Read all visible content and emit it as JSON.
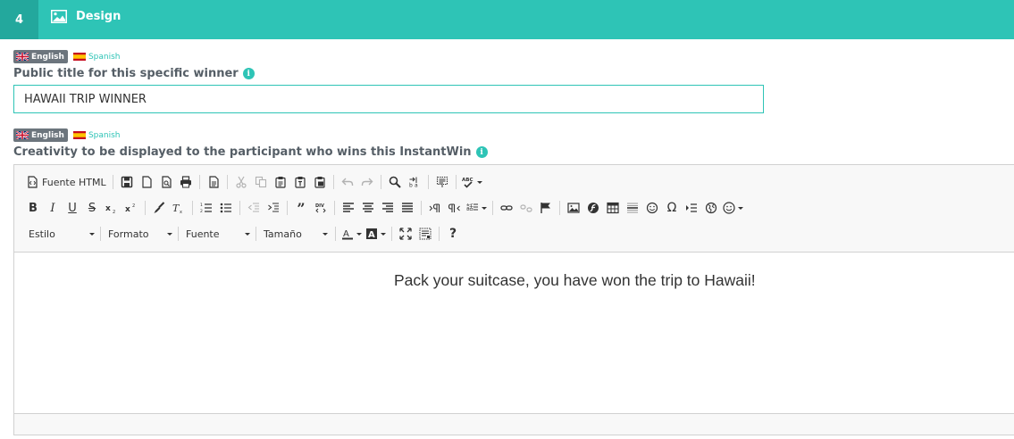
{
  "step": {
    "number": "4",
    "icon": "image-icon",
    "label": "Design"
  },
  "languages": [
    {
      "code": "en",
      "label": "English",
      "flag": "uk-flag-icon",
      "active": true
    },
    {
      "code": "es",
      "label": "Spanish",
      "flag": "spain-flag-icon",
      "active": false
    }
  ],
  "title_field": {
    "label": "Public title for this specific winner",
    "value": "HAWAII TRIP WINNER"
  },
  "creativity_field": {
    "label": "Creativity to be displayed to the participant who wins this InstantWin"
  },
  "editor": {
    "toolbar": {
      "source_label": "Fuente HTML",
      "style_combo": "Estilo",
      "format_combo": "Formato",
      "font_combo": "Fuente",
      "size_combo": "Tamaño",
      "help_label": "?"
    },
    "content_text": "Pack your suitcase, you have won the trip to Hawaii!"
  },
  "colors": {
    "accent": "#2ec4b6",
    "accent_dark": "#23a89d",
    "active_lang_bg": "#6c757d"
  }
}
